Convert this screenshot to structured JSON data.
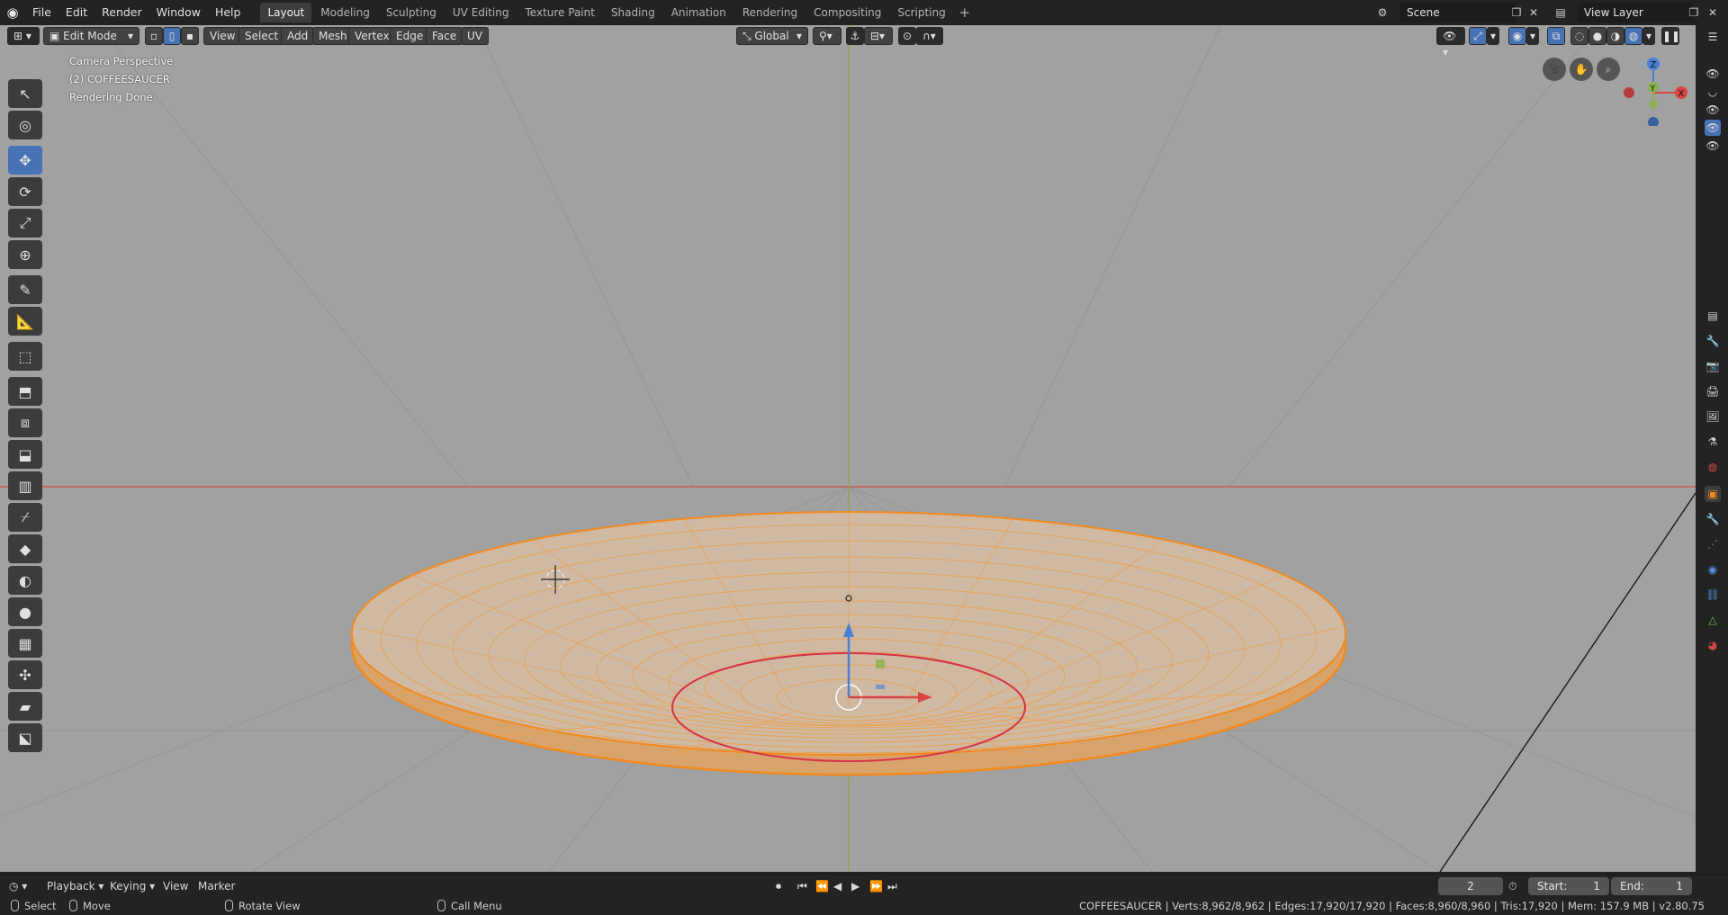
{
  "app": {
    "menu": [
      "File",
      "Edit",
      "Render",
      "Window",
      "Help"
    ],
    "workspace_tabs": [
      "Layout",
      "Modeling",
      "Sculpting",
      "UV Editing",
      "Texture Paint",
      "Shading",
      "Animation",
      "Rendering",
      "Compositing",
      "Scripting"
    ],
    "active_tab": "Layout",
    "scene_name": "Scene",
    "view_layer_name": "View Layer"
  },
  "viewport_header": {
    "mode": "Edit Mode",
    "menus": [
      "View",
      "Select",
      "Add",
      "Mesh",
      "Vertex",
      "Edge",
      "Face",
      "UV"
    ],
    "transform_orientation": "Global"
  },
  "viewport_overlay": {
    "line1": "Camera Perspective",
    "line2": "(2) COFFEESAUCER",
    "line3": "Rendering Done"
  },
  "gizmo": {
    "x_label": "X",
    "y_label": "Y",
    "z_label": "Z"
  },
  "tools": [
    "select-box",
    "cursor",
    "move",
    "rotate",
    "scale",
    "transform",
    "annotate",
    "measure",
    "add-cube",
    "extrude-region",
    "inset-faces",
    "bevel",
    "loop-cut",
    "knife",
    "poly-build",
    "spin",
    "smooth",
    "edge-slide",
    "shrink-fatten",
    "shear",
    "rip-region"
  ],
  "active_tool": "move",
  "timeline": {
    "menus": [
      "Playback",
      "Keying",
      "View",
      "Marker"
    ],
    "current_frame": "2",
    "start_label": "Start:",
    "start_value": "1",
    "end_label": "End:",
    "end_value": "1"
  },
  "statusbar": {
    "select": "Select",
    "move": "Move",
    "rotate_view": "Rotate View",
    "call_menu": "Call Menu",
    "stats": "COFFEESAUCER | Verts:8,962/8,962 | Edges:17,920/17,920 | Faces:8,960/8,960 | Tris:17,920 | Mem: 157.9 MB | v2.80.75"
  },
  "colors": {
    "accent": "#4772b3",
    "viewport_bg": "#a1a1a1",
    "mesh_wire": "#f28a1e",
    "x_axis": "#d94545",
    "y_axis": "#8bb14a",
    "z_axis": "#4a7fd6"
  }
}
